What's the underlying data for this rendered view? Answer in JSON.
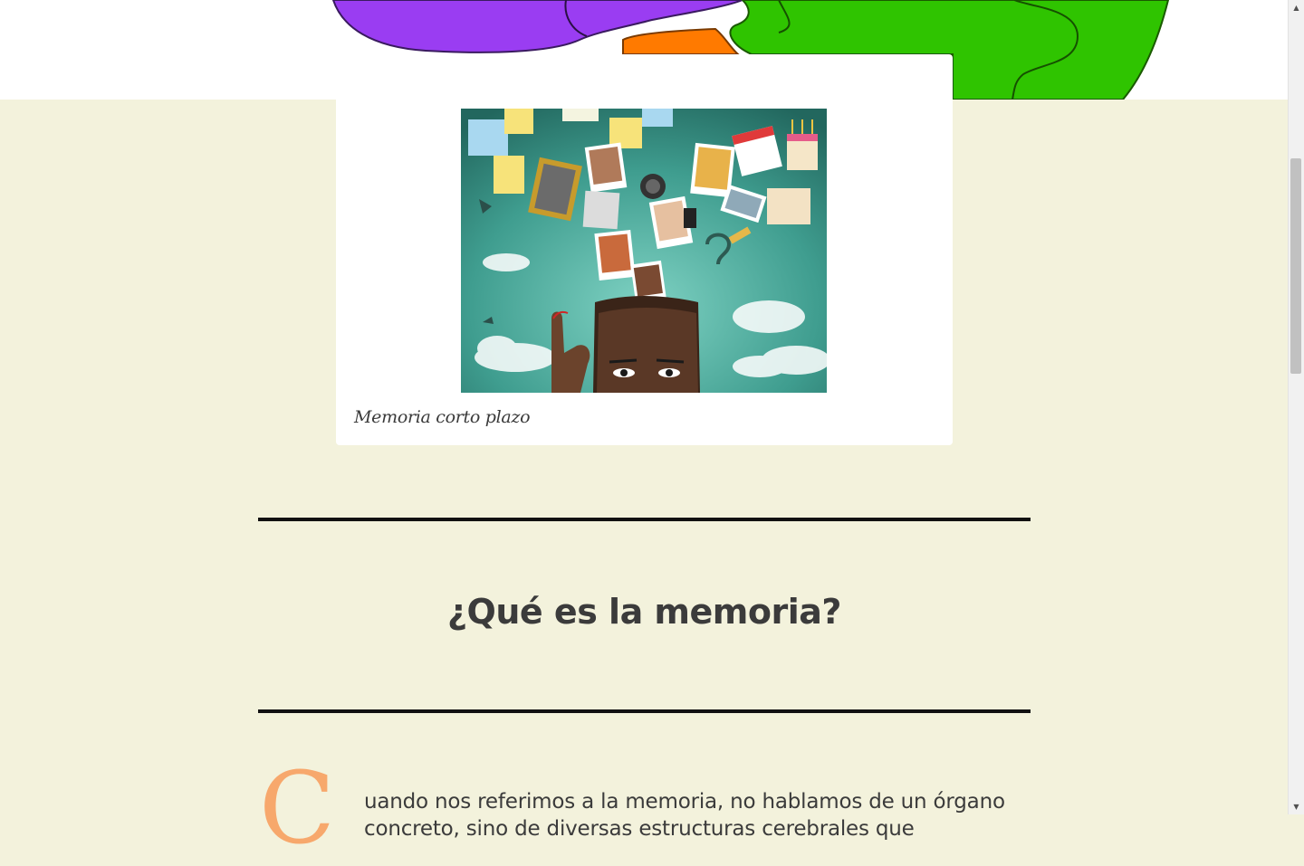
{
  "figure": {
    "caption": "Memoria corto plazo"
  },
  "section": {
    "heading": "¿Qué es la memoria?"
  },
  "article": {
    "drop_cap": "C",
    "first_paragraph": "uando nos referimos a la memoria, no hablamos de un órgano concreto, sino de diversas estructuras cerebrales que"
  },
  "colors": {
    "page_background": "#f3f2dc",
    "drop_cap": "#f7a86c",
    "puzzle_purple": "#9a3df2",
    "puzzle_green": "#2fc400",
    "puzzle_orange": "#ff7a00"
  },
  "scrollbar": {
    "up_icon": "scroll-up-arrow-icon",
    "down_icon": "scroll-down-arrow-icon"
  }
}
